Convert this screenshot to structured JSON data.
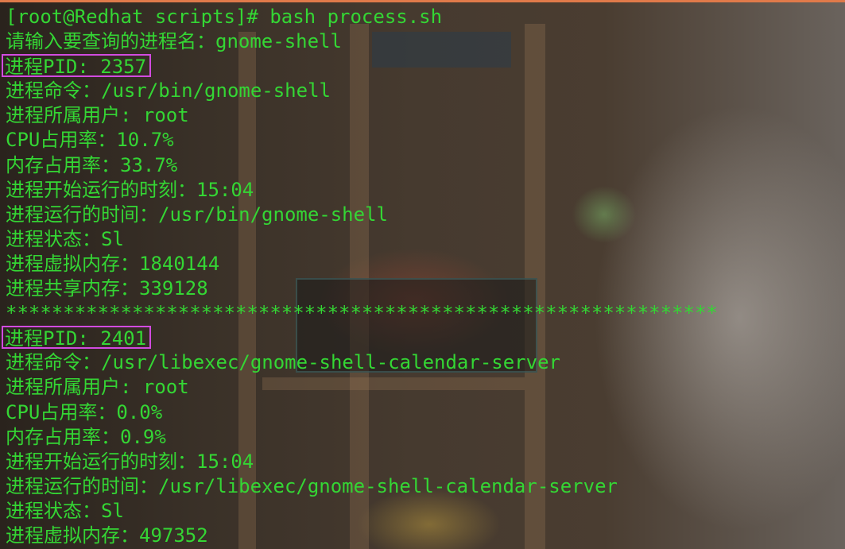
{
  "terminal": {
    "lines": [
      {
        "text": "[root@Redhat scripts]# bash process.sh",
        "boxed": false
      },
      {
        "text": "请输入要查询的进程名：gnome-shell",
        "boxed": false
      },
      {
        "text": "进程PID: 2357",
        "boxed": true
      },
      {
        "text": "进程命令：/usr/bin/gnome-shell",
        "boxed": false
      },
      {
        "text": "进程所属用户: root",
        "boxed": false
      },
      {
        "text": "CPU占用率：10.7%",
        "boxed": false
      },
      {
        "text": "内存占用率：33.7%",
        "boxed": false
      },
      {
        "text": "进程开始运行的时刻：15:04",
        "boxed": false
      },
      {
        "text": "进程运行的时间：/usr/bin/gnome-shell",
        "boxed": false
      },
      {
        "text": "进程状态：Sl",
        "boxed": false
      },
      {
        "text": "进程虚拟内存：1840144",
        "boxed": false
      },
      {
        "text": "进程共享内存：339128",
        "boxed": false
      },
      {
        "text": "**************************************************************",
        "boxed": false
      },
      {
        "text": "进程PID: 2401",
        "boxed": true
      },
      {
        "text": "进程命令：/usr/libexec/gnome-shell-calendar-server",
        "boxed": false
      },
      {
        "text": "进程所属用户: root",
        "boxed": false
      },
      {
        "text": "CPU占用率：0.0%",
        "boxed": false
      },
      {
        "text": "内存占用率：0.9%",
        "boxed": false
      },
      {
        "text": "进程开始运行的时刻：15:04",
        "boxed": false
      },
      {
        "text": "进程运行的时间：/usr/libexec/gnome-shell-calendar-server",
        "boxed": false
      },
      {
        "text": "进程状态：Sl",
        "boxed": false
      },
      {
        "text": "进程虚拟内存：497352",
        "boxed": false
      }
    ]
  },
  "colors": {
    "text": "#34d634",
    "highlight_border": "#d24be0",
    "window_border": "#e07a4a"
  }
}
